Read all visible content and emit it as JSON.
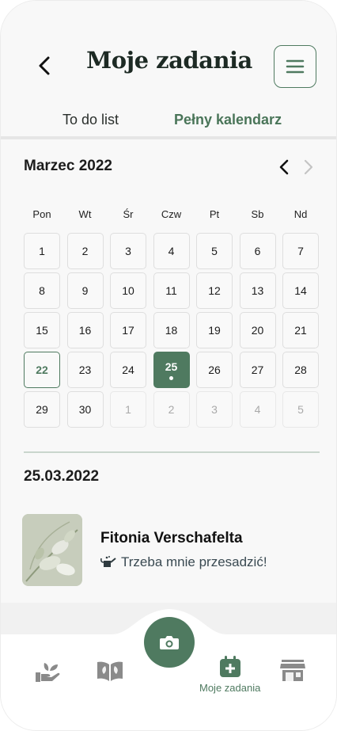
{
  "header": {
    "title": "Moje zadania",
    "back_icon": "chevron-left-icon",
    "menu_icon": "hamburger-menu-icon"
  },
  "tabs": [
    {
      "label": "To do list",
      "active": false
    },
    {
      "label": "Pełny kalendarz",
      "active": true
    }
  ],
  "calendar": {
    "month_label": "Marzec 2022",
    "weekdays": [
      "Pon",
      "Wt",
      "Śr",
      "Czw",
      "Pt",
      "Sb",
      "Nd"
    ],
    "days": [
      {
        "label": "1"
      },
      {
        "label": "2"
      },
      {
        "label": "3"
      },
      {
        "label": "4"
      },
      {
        "label": "5"
      },
      {
        "label": "6"
      },
      {
        "label": "7"
      },
      {
        "label": "8"
      },
      {
        "label": "9"
      },
      {
        "label": "10"
      },
      {
        "label": "11"
      },
      {
        "label": "12"
      },
      {
        "label": "13"
      },
      {
        "label": "14"
      },
      {
        "label": "15"
      },
      {
        "label": "16"
      },
      {
        "label": "17"
      },
      {
        "label": "18"
      },
      {
        "label": "19"
      },
      {
        "label": "20"
      },
      {
        "label": "21"
      },
      {
        "label": "22",
        "state": "today"
      },
      {
        "label": "23"
      },
      {
        "label": "24"
      },
      {
        "label": "25",
        "state": "selected",
        "has_task": true
      },
      {
        "label": "26"
      },
      {
        "label": "27"
      },
      {
        "label": "28"
      },
      {
        "label": "29"
      },
      {
        "label": "30"
      },
      {
        "label": "1",
        "state": "muted"
      },
      {
        "label": "2",
        "state": "muted"
      },
      {
        "label": "3",
        "state": "muted"
      },
      {
        "label": "4",
        "state": "muted"
      },
      {
        "label": "5",
        "state": "muted"
      }
    ]
  },
  "selected_date": "25.03.2022",
  "task": {
    "plant_name": "Fitonia Verschafelta",
    "note": "Trzeba mnie przesadzić!",
    "note_icon": "watering-can-icon"
  },
  "bottom_nav": {
    "items": [
      {
        "icon": "hand-plant-icon",
        "label": ""
      },
      {
        "icon": "book-leaf-icon",
        "label": ""
      },
      {
        "icon": "calendar-plus-icon",
        "label": "Moje zadania",
        "active": true
      },
      {
        "icon": "shop-icon",
        "label": ""
      }
    ],
    "center_action_icon": "camera-icon"
  },
  "colors": {
    "accent": "#4f7a60",
    "background": "#f8f8f8",
    "muted_text": "#a9a9a9"
  }
}
